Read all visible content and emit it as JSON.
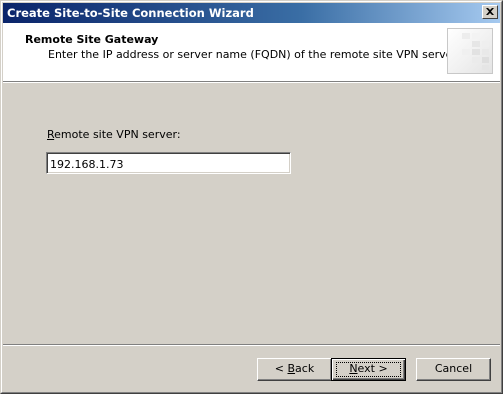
{
  "window": {
    "title": "Create Site-to-Site Connection Wizard"
  },
  "icons": {
    "close": "close-icon",
    "header_graphic": "wizard-banner-icon"
  },
  "header": {
    "title": "Remote Site Gateway",
    "description": "Enter the IP address or server name (FQDN) of the remote site VPN server."
  },
  "form": {
    "vpn_server_label_accel": "R",
    "vpn_server_label_rest": "emote site VPN server:",
    "vpn_server_value": "192.168.1.73"
  },
  "buttons": {
    "back_prefix": "< ",
    "back_accel": "B",
    "back_rest": "ack",
    "next_accel": "N",
    "next_rest": "ext >",
    "cancel": "Cancel"
  },
  "colors": {
    "titlebar_start": "#0a246a",
    "titlebar_end": "#a6caf0",
    "face": "#d4d0c8"
  }
}
